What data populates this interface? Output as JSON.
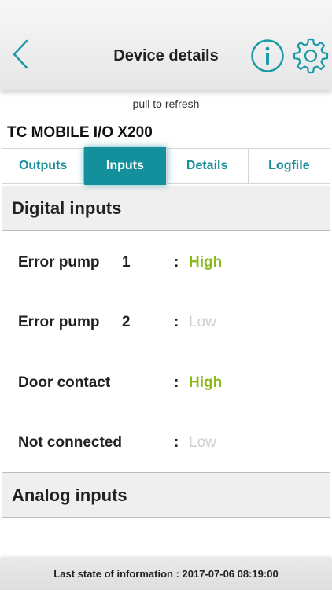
{
  "header": {
    "title": "Device details",
    "back_icon": "chevron-left-icon",
    "info_icon": "info-icon",
    "settings_icon": "gear-icon",
    "accent_color": "#1a9aa6"
  },
  "pull_to_refresh": "pull to refresh",
  "device": {
    "name": "TC MOBILE I/O X200"
  },
  "tabs": [
    {
      "label": "Outputs",
      "active": false
    },
    {
      "label": "Inputs",
      "active": true
    },
    {
      "label": "Details",
      "active": false
    },
    {
      "label": "Logfile",
      "active": false
    }
  ],
  "digital_inputs": {
    "title": "Digital inputs",
    "separator": ":",
    "rows": [
      {
        "label": "Error pump",
        "number": "1",
        "value": "High",
        "state": "high"
      },
      {
        "label": "Error pump",
        "number": "2",
        "value": "Low",
        "state": "low"
      },
      {
        "label": "Door contact",
        "number": "",
        "value": "High",
        "state": "high"
      },
      {
        "label": "Not connected",
        "number": "",
        "value": "Low",
        "state": "low"
      }
    ],
    "high_color": "#8cba18",
    "low_color": "#cfcfcf"
  },
  "analog_inputs": {
    "title": "Analog inputs"
  },
  "footer": {
    "text": "Last state of information : 2017-07-06 08:19:00"
  }
}
